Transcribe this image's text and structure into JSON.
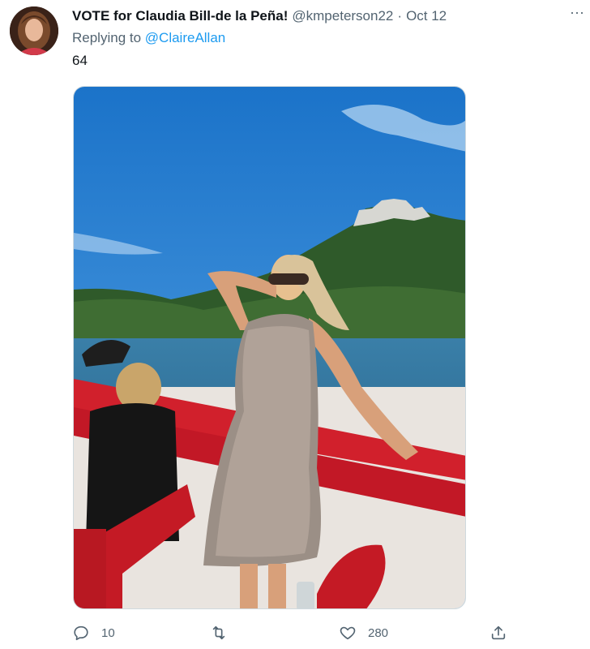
{
  "tweet": {
    "display_name": "VOTE for Claudia Bill-de la Peña!",
    "handle": "@kmpeterson22",
    "separator": "·",
    "date": "Oct 12",
    "more_label": "···",
    "replying_prefix": "Replying to ",
    "replying_to": "@ClaireAllan",
    "text": "64",
    "avatar_icon": "user-avatar",
    "media_icon": "photo"
  },
  "actions": {
    "reply": {
      "icon": "reply-icon",
      "count": "10"
    },
    "retweet": {
      "icon": "retweet-icon",
      "count": ""
    },
    "like": {
      "icon": "heart-icon",
      "count": "280"
    },
    "share": {
      "icon": "share-icon",
      "count": ""
    }
  },
  "colors": {
    "text": "#0f1419",
    "secondary": "#536471",
    "link": "#1d9bf0",
    "border": "#cfd9de"
  }
}
